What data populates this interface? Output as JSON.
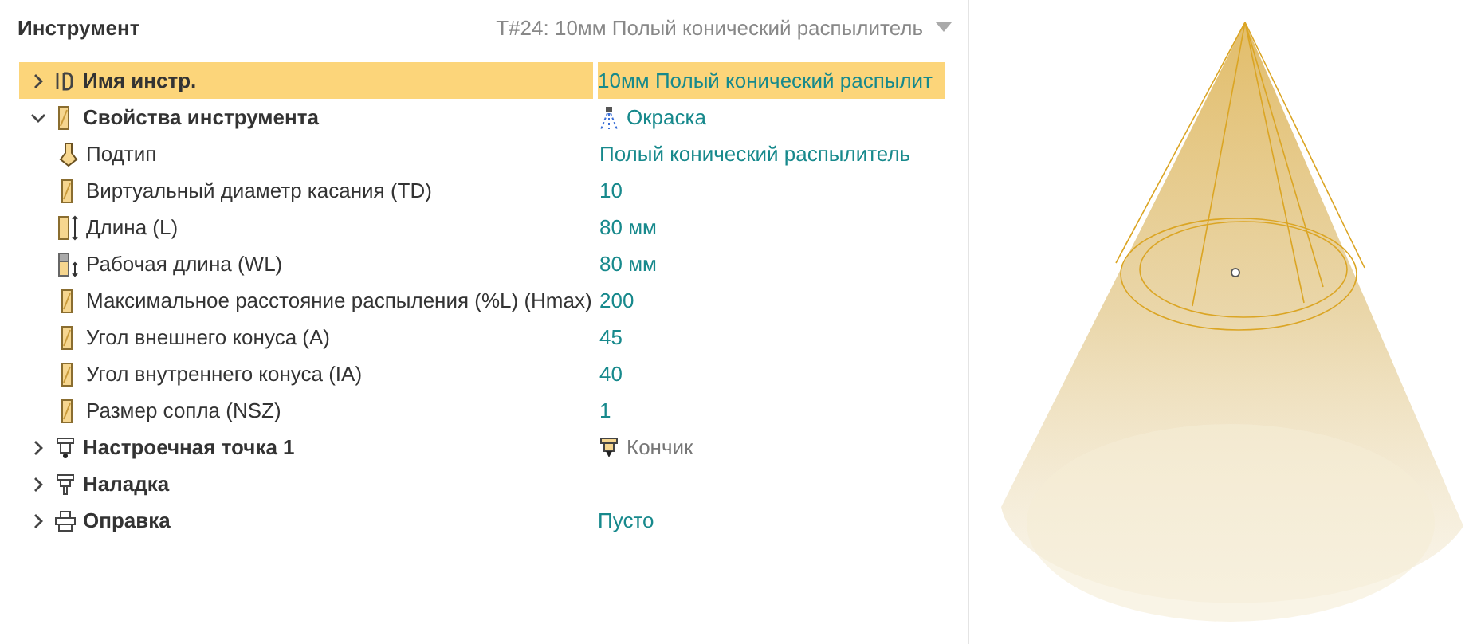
{
  "panel": {
    "title": "Инструмент",
    "tool_selector": "T#24: 10мм Полый конический распылитель"
  },
  "tree": [
    {
      "kind": "id",
      "label": "Имя инстр.",
      "value": "10мм Полый конический распылит",
      "expanded": false,
      "selected": true
    },
    {
      "kind": "tool",
      "label": "Свойства инструмента",
      "value": {
        "text": "Окраска",
        "kind": "spray"
      },
      "expanded": true,
      "selected": false,
      "children": [
        {
          "kind": "subtype",
          "label": "Подтип",
          "value": "Полый конический распылитель",
          "selected": false
        },
        {
          "kind": "param",
          "label": "Виртуальный диаметр касания (TD)",
          "value": "10",
          "selected": false
        },
        {
          "kind": "length",
          "label": "Длина (L)",
          "value": "80 мм",
          "selected": false
        },
        {
          "kind": "working-length",
          "label": "Рабочая длина (WL)",
          "value": "80 мм",
          "selected": false
        },
        {
          "kind": "param",
          "label": "Максимальное расстояние распыления (%L) (Hmax)",
          "value": "200",
          "selected": false
        },
        {
          "kind": "param",
          "label": "Угол внешнего конуса (A)",
          "value": "45",
          "selected": false
        },
        {
          "kind": "param",
          "label": "Угол внутреннего конуса (IA)",
          "value": "40",
          "selected": false
        },
        {
          "kind": "param",
          "label": "Размер сопла (NSZ)",
          "value": "1",
          "selected": false
        }
      ]
    },
    {
      "kind": "setpoint",
      "label": "Настроечная точка 1",
      "value": {
        "text": "Кончик",
        "kind": "tip"
      },
      "expanded": false,
      "selected": false
    },
    {
      "kind": "setup",
      "label": "Наладка",
      "expanded": false,
      "selected": false
    },
    {
      "kind": "holder",
      "label": "Оправка",
      "value": "Пусто",
      "expanded": false,
      "selected": false
    }
  ]
}
